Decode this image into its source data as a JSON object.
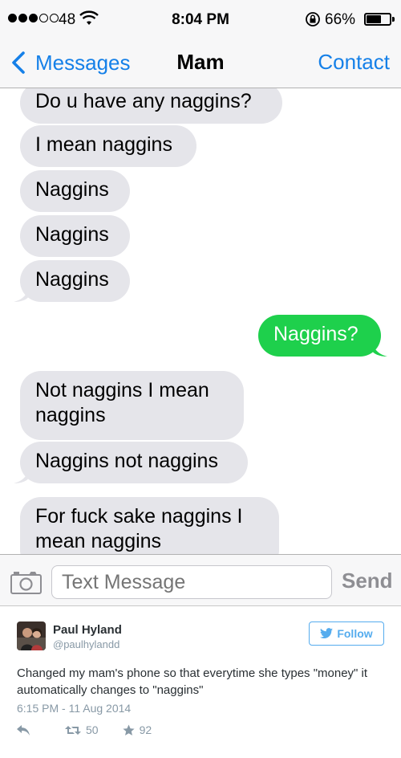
{
  "status_bar": {
    "carrier": "48",
    "time": "8:04 PM",
    "battery_percent": "66%",
    "battery_level": 0.66,
    "signal_bars_filled": 3,
    "signal_bars_total": 5,
    "icons": [
      "signal-dots-icon",
      "wifi-icon",
      "orientation-lock-icon",
      "battery-icon"
    ]
  },
  "nav": {
    "back_label": "Messages",
    "title": "Mam",
    "contact_label": "Contact"
  },
  "messages": [
    {
      "text": "Do u have any naggins?",
      "direction": "received"
    },
    {
      "text": "I mean naggins",
      "direction": "received"
    },
    {
      "text": "Naggins",
      "direction": "received"
    },
    {
      "text": "Naggins",
      "direction": "received"
    },
    {
      "text": "Naggins",
      "direction": "received"
    },
    {
      "text": "Naggins?",
      "direction": "sent"
    },
    {
      "text": "Not naggins I mean naggins",
      "direction": "received"
    },
    {
      "text": "Naggins not naggins",
      "direction": "received"
    },
    {
      "text": "For fuck sake naggins I mean naggins",
      "direction": "received"
    }
  ],
  "input_bar": {
    "placeholder": "Text Message",
    "send_label": "Send"
  },
  "tweet": {
    "author_name": "Paul Hyland",
    "author_handle": "@paulhylandd",
    "follow_label": "Follow",
    "text": "Changed my mam's phone so that everytime she types \"money\" it automatically changes to \"naggins\"",
    "date": "6:15 PM - 11 Aug 2014",
    "retweets": "50",
    "favorites": "92"
  },
  "colors": {
    "ios_blue": "#1580e8",
    "received_bubble": "#e5e5ea",
    "sent_bubble": "#1ed04c",
    "twitter_blue": "#55acee"
  }
}
